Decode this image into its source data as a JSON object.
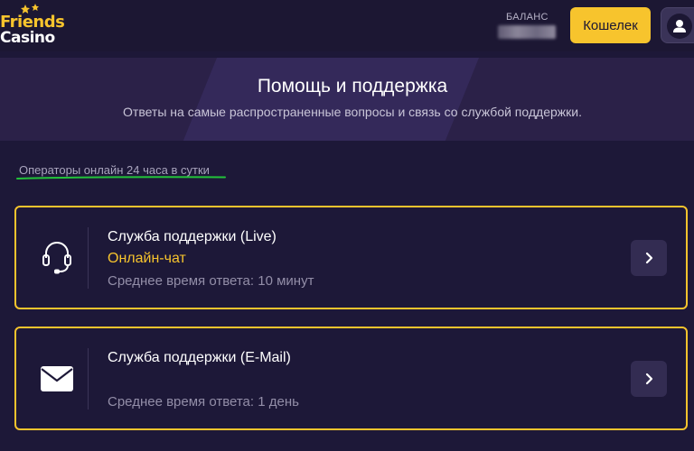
{
  "header": {
    "logo": {
      "line1": "Friends",
      "line2": "Casino"
    },
    "balance_label": "БАЛАНС",
    "wallet_label": "Кошелек"
  },
  "banner": {
    "title": "Помощь и поддержка",
    "subtitle": "Ответы на самые распространенные вопросы и связь со службой поддержки."
  },
  "operators_note": "Операторы онлайн 24 часа в сутки",
  "support": [
    {
      "title": "Служба поддержки (Live)",
      "subtitle": "Онлайн-чат",
      "response": "Среднее время ответа: 10 минут",
      "icon": "headset-icon"
    },
    {
      "title": "Служба поддержки (E-Mail)",
      "subtitle": "",
      "response": "Среднее время ответа: 1 день",
      "icon": "envelope-icon"
    }
  ],
  "colors": {
    "background": "#1d1838",
    "accent": "#f7c42d",
    "banner": "#2b2148",
    "underline": "#22c33a"
  }
}
